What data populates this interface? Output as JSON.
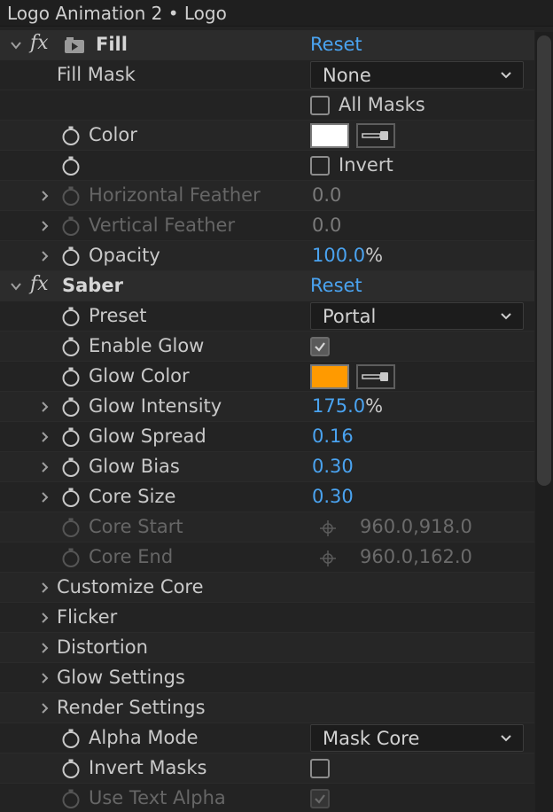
{
  "panel_title": "Logo Animation 2 • Logo",
  "fill": {
    "name": "Fill",
    "reset": "Reset",
    "fill_mask_label": "Fill Mask",
    "fill_mask_value": "None",
    "all_masks_label": "All Masks",
    "color_label": "Color",
    "color_value": "#ffffff",
    "invert_label": "Invert",
    "horizontal_feather_label": "Horizontal Feather",
    "horizontal_feather_value": "0.0",
    "vertical_feather_label": "Vertical Feather",
    "vertical_feather_value": "0.0",
    "opacity_label": "Opacity",
    "opacity_value": "100.0",
    "opacity_unit": "%"
  },
  "saber": {
    "name": "Saber",
    "reset": "Reset",
    "preset_label": "Preset",
    "preset_value": "Portal",
    "enable_glow_label": "Enable Glow",
    "enable_glow_checked": true,
    "glow_color_label": "Glow Color",
    "glow_color_value": "#ff9a00",
    "glow_intensity_label": "Glow Intensity",
    "glow_intensity_value": "175.0",
    "glow_intensity_unit": "%",
    "glow_spread_label": "Glow Spread",
    "glow_spread_value": "0.16",
    "glow_bias_label": "Glow Bias",
    "glow_bias_value": "0.30",
    "core_size_label": "Core Size",
    "core_size_value": "0.30",
    "core_start_label": "Core Start",
    "core_start_value": "960.0,918.0",
    "core_end_label": "Core End",
    "core_end_value": "960.0,162.0",
    "customize_core_label": "Customize Core",
    "flicker_label": "Flicker",
    "distortion_label": "Distortion",
    "glow_settings_label": "Glow Settings",
    "render_settings_label": "Render Settings",
    "alpha_mode_label": "Alpha Mode",
    "alpha_mode_value": "Mask Core",
    "invert_masks_label": "Invert Masks",
    "invert_masks_checked": false,
    "use_text_alpha_label": "Use Text Alpha",
    "use_text_alpha_checked": true
  },
  "colors": {
    "accent_blue": "#4aa3f0",
    "background": "#232323",
    "glow_orange": "#ff9a00"
  }
}
